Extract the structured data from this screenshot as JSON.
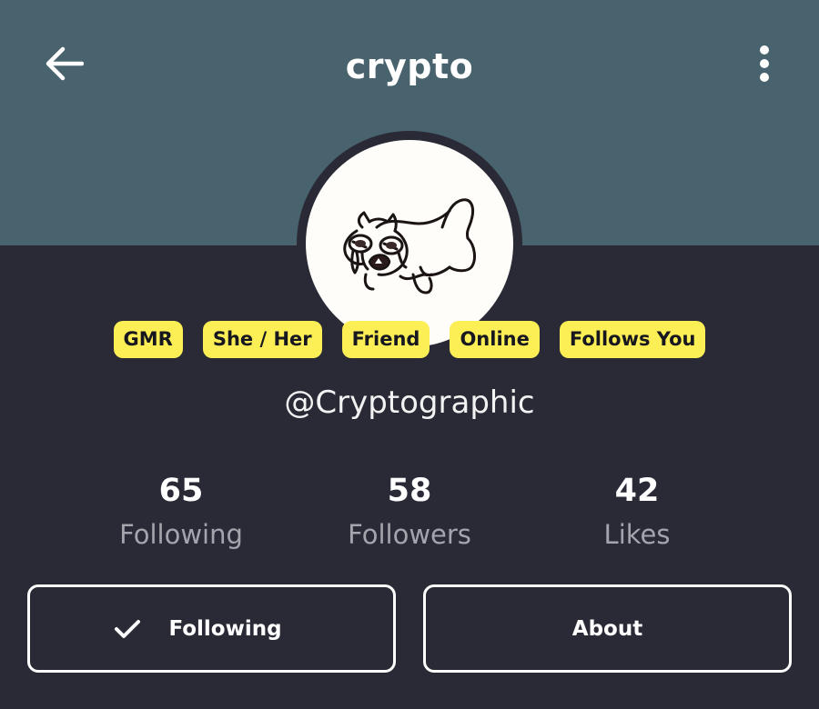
{
  "header": {
    "title": "crypto",
    "back_icon": "arrow-left-icon",
    "menu_icon": "more-vertical-icon"
  },
  "profile": {
    "avatar_icon": "cat-drawing-avatar",
    "tags": [
      "GMR",
      "She / Her",
      "Friend",
      "Online",
      "Follows You"
    ],
    "handle": "@Cryptographic"
  },
  "stats": [
    {
      "value": "65",
      "label": "Following"
    },
    {
      "value": "58",
      "label": "Followers"
    },
    {
      "value": "42",
      "label": "Likes"
    }
  ],
  "actions": {
    "following_label": "Following",
    "following_icon": "checkmark-icon",
    "about_label": "About"
  },
  "colors": {
    "header_bg": "#48636e",
    "body_bg": "#292a36",
    "tag_bg": "#fcee55",
    "tag_text": "#17171f",
    "muted_text": "#a3a5ad"
  }
}
